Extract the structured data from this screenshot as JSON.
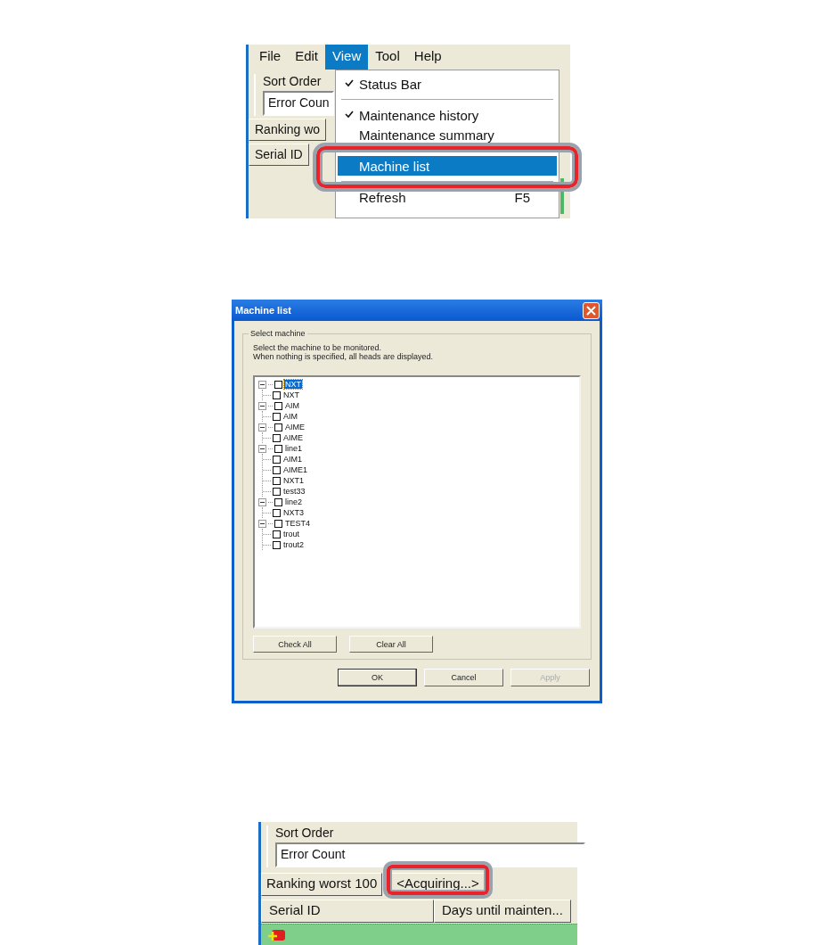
{
  "menu_screenshot": {
    "menubar": [
      {
        "label": "File",
        "selected": false
      },
      {
        "label": "Edit",
        "selected": false
      },
      {
        "label": "View",
        "selected": true
      },
      {
        "label": "Tool",
        "selected": false
      },
      {
        "label": "Help",
        "selected": false
      }
    ],
    "sort_order_label": "Sort Order",
    "sort_field": {
      "value": "Error Coun"
    },
    "headers": [
      {
        "label": "Ranking wo"
      },
      {
        "label": "Serial ID"
      }
    ],
    "view_menu": [
      {
        "kind": "item",
        "label": "Status Bar",
        "checked": true,
        "selected": false,
        "callout": false
      },
      {
        "kind": "separator"
      },
      {
        "kind": "item",
        "label": "Maintenance history",
        "checked": true,
        "selected": false,
        "callout": false
      },
      {
        "kind": "item",
        "label": "Maintenance summary",
        "checked": false,
        "selected": false,
        "callout": false
      },
      {
        "kind": "separator"
      },
      {
        "kind": "item",
        "label": "Machine list",
        "checked": false,
        "selected": true,
        "callout": true
      },
      {
        "kind": "separator"
      },
      {
        "kind": "item",
        "label": "Refresh",
        "shortcut": "F5",
        "checked": false,
        "selected": false,
        "callout": false
      }
    ]
  },
  "dialog": {
    "title": "Machine list",
    "group_label": "Select machine",
    "description": [
      "Select the machine to be monitored.",
      "When nothing is specified, all heads are displayed."
    ],
    "tree": [
      {
        "label": "NXT",
        "checked": false,
        "expanded": true,
        "selected": true,
        "children": [
          {
            "label": "NXT",
            "checked": false,
            "selected": false
          }
        ]
      },
      {
        "label": "AIM",
        "checked": false,
        "expanded": true,
        "selected": false,
        "children": [
          {
            "label": "AIM",
            "checked": false,
            "selected": false
          }
        ]
      },
      {
        "label": "AIME",
        "checked": false,
        "expanded": true,
        "selected": false,
        "children": [
          {
            "label": "AIME",
            "checked": false,
            "selected": false
          }
        ]
      },
      {
        "label": "line1",
        "checked": false,
        "expanded": true,
        "selected": false,
        "children": [
          {
            "label": "AIM1",
            "checked": false,
            "selected": false
          },
          {
            "label": "AIME1",
            "checked": false,
            "selected": false
          },
          {
            "label": "NXT1",
            "checked": false,
            "selected": false
          },
          {
            "label": "test33",
            "checked": false,
            "selected": false
          }
        ]
      },
      {
        "label": "line2",
        "checked": false,
        "expanded": true,
        "selected": false,
        "children": [
          {
            "label": "NXT3",
            "checked": false,
            "selected": false
          }
        ]
      },
      {
        "label": "TEST4",
        "checked": false,
        "expanded": true,
        "selected": false,
        "children": [
          {
            "label": "trout",
            "checked": false,
            "selected": false
          },
          {
            "label": "trout2",
            "checked": false,
            "selected": false
          }
        ]
      }
    ],
    "tree_buttons": [
      {
        "label": "Check All"
      },
      {
        "label": "Clear All"
      }
    ],
    "buttons": [
      {
        "label": "OK",
        "disabled": false,
        "default": true
      },
      {
        "label": "Cancel",
        "disabled": false,
        "default": false
      },
      {
        "label": "Apply",
        "disabled": true,
        "default": false
      }
    ]
  },
  "acquiring_screenshot": {
    "sort_order_label": "Sort Order",
    "sort_field": {
      "value": "Error Count"
    },
    "headers": [
      {
        "label": "Ranking worst 100",
        "callout": false
      },
      {
        "label": "<Acquiring...>",
        "callout": true
      }
    ],
    "columns": [
      {
        "label": "Serial ID"
      },
      {
        "label": "Days until mainten..."
      }
    ]
  }
}
